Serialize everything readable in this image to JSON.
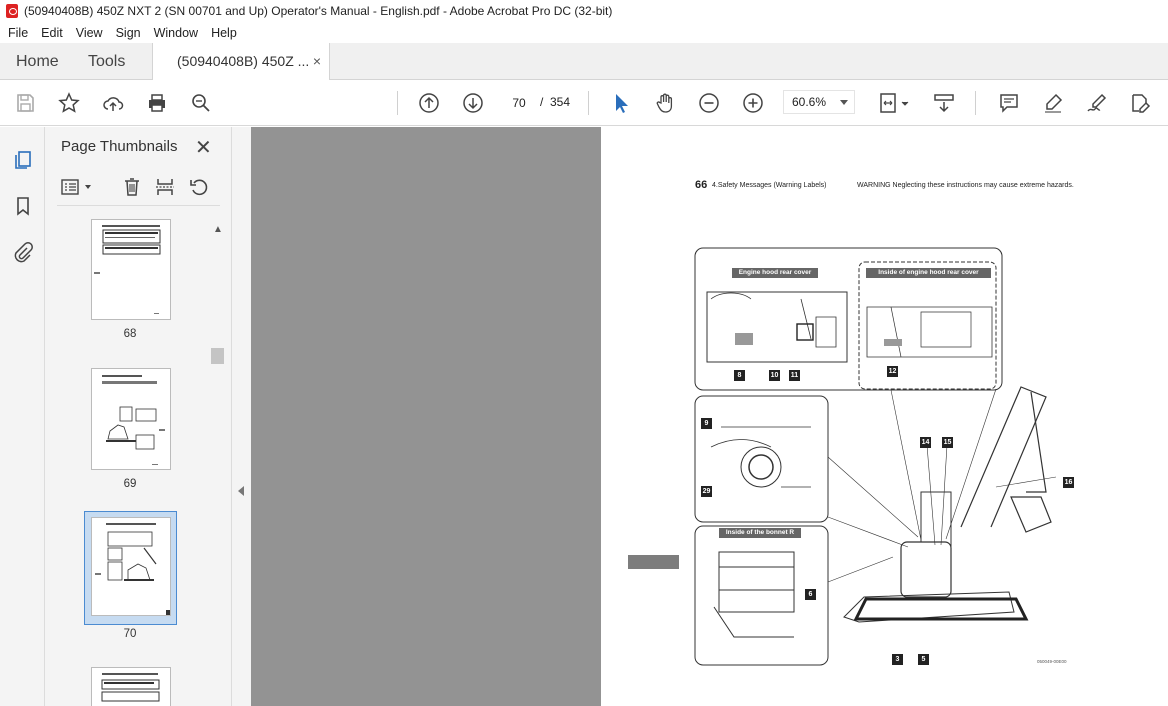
{
  "window": {
    "title": "(50940408B) 450Z NXT 2 (SN 00701 and Up) Operator's Manual - English.pdf - Adobe Acrobat Pro DC (32-bit)"
  },
  "menu": [
    "File",
    "Edit",
    "View",
    "Sign",
    "Window",
    "Help"
  ],
  "tabs": {
    "home": "Home",
    "tools": "Tools",
    "document": "(50940408B) 450Z ...",
    "close_symbol": "×"
  },
  "toolbar": {
    "icons": [
      "save-icon",
      "star-icon",
      "upload-icon",
      "print-icon",
      "zoom-search-icon",
      "page-up-icon",
      "page-down-icon",
      "select-cursor-icon",
      "hand-icon",
      "zoom-out-icon",
      "zoom-in-icon",
      "fit-page-icon",
      "scroll-mode-icon",
      "comment-icon",
      "highlight-icon",
      "sign-icon",
      "edit-pdf-icon"
    ],
    "current_page": "70",
    "page_separator": "/",
    "total_pages": "354",
    "zoom": "60.6%"
  },
  "thumbnails_panel": {
    "title": "Page Thumbnails",
    "close_symbol": "✕",
    "pages": [
      {
        "number": "68",
        "selected": false
      },
      {
        "number": "69",
        "selected": false
      },
      {
        "number": "70",
        "selected": true
      }
    ]
  },
  "document_page": {
    "page_number": "66",
    "section": "4.Safety Messages (Warning Labels)",
    "warning": "WARNING Neglecting these instructions may cause extreme hazards.",
    "captions": {
      "engine_hood_rear_cover": "Engine hood rear cover",
      "inside_engine_hood_rear_cover": "Inside of engine hood rear cover",
      "inside_bonnet_r": "Inside of the bonnet R"
    },
    "labels": [
      "8",
      "10",
      "11",
      "12",
      "9",
      "29",
      "6",
      "14",
      "15",
      "16",
      "3",
      "5"
    ],
    "diagram_code": "050049-00E00"
  },
  "colors": {
    "selection_fill": "#c6dbf1",
    "selection_border": "#4b8bd1",
    "viewer_background": "#939393",
    "accent_blue": "#2a6ebb"
  }
}
